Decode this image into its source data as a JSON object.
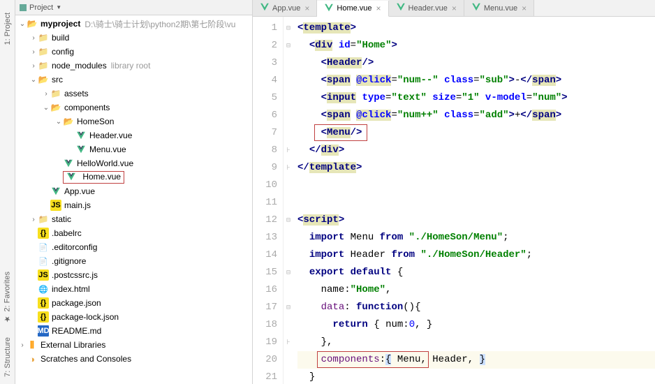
{
  "leftTools": {
    "project": "1: Project",
    "favorites": "2: Favorites",
    "structure": "7: Structure"
  },
  "sidebar": {
    "title": "Project",
    "tree": {
      "root": {
        "name": "myproject",
        "path": "D:\\骑士\\骑士计划\\python2期\\第七阶段\\vu"
      },
      "build": "build",
      "config": "config",
      "nodeModules": {
        "name": "node_modules",
        "hint": "library root"
      },
      "src": "src",
      "assets": "assets",
      "components": "components",
      "homeson": "HomeSon",
      "headerVue": "Header.vue",
      "menuVue": "Menu.vue",
      "helloWorld": "HelloWorld.vue",
      "homeVue": "Home.vue",
      "appVue": "App.vue",
      "mainJs": "main.js",
      "static": "static",
      "babelrc": ".babelrc",
      "editorconfig": ".editorconfig",
      "gitignore": ".gitignore",
      "postcssrc": ".postcssrc.js",
      "indexHtml": "index.html",
      "packageJson": "package.json",
      "packageLock": "package-lock.json",
      "readme": "README.md",
      "extLib": "External Libraries",
      "scratches": "Scratches and Consoles"
    }
  },
  "tabs": {
    "app": "App.vue",
    "home": "Home.vue",
    "header": "Header.vue",
    "menu": "Menu.vue"
  },
  "code": {
    "lines": {
      "1": "1",
      "2": "2",
      "3": "3",
      "4": "4",
      "5": "5",
      "6": "6",
      "7": "7",
      "8": "8",
      "9": "9",
      "10": "10",
      "11": "11",
      "12": "12",
      "13": "13",
      "14": "14",
      "15": "15",
      "16": "16",
      "17": "17",
      "18": "18",
      "19": "19",
      "20": "20",
      "21": "21"
    },
    "l1": {
      "open": "<",
      "tag": "template",
      "close": ">"
    },
    "l2": {
      "open": "<",
      "tag": "div",
      "attr": "id",
      "eq": "=",
      "q": "\"",
      "val": "Home",
      "close": ">"
    },
    "l3": {
      "open": "<",
      "tag": "Header",
      "close": "/>"
    },
    "l4": {
      "open": "<",
      "tag": "span",
      "attr1": "@click",
      "eq": "=",
      "q": "\"",
      "val1": "num--",
      "attr2": "class",
      "val2": "sub",
      "close": ">",
      "text": "-",
      "ctag": "</",
      "close2": ">"
    },
    "l5": {
      "open": "<",
      "tag": "input",
      "attr1": "type",
      "eq": "=",
      "q": "\"",
      "val1": "text",
      "attr2": "size",
      "val2": "1",
      "attr3": "v-model",
      "val3": "num",
      "close": ">"
    },
    "l6": {
      "open": "<",
      "tag": "span",
      "attr1": "@click",
      "eq": "=",
      "q": "\"",
      "val1": "num++",
      "attr2": "class",
      "val2": "add",
      "close": ">",
      "text": "+",
      "ctag": "</",
      "close2": ">"
    },
    "l7": {
      "open": "<",
      "tag": "Menu",
      "close": "/>"
    },
    "l8": {
      "open": "</",
      "tag": "div",
      "close": ">"
    },
    "l9": {
      "open": "</",
      "tag": "template",
      "close": ">"
    },
    "l12": {
      "open": "<",
      "tag": "script",
      "close": ">"
    },
    "l13": {
      "kw": "import",
      "name": "Menu",
      "from": "from",
      "path": "\"./HomeSon/Menu\"",
      "semi": ";"
    },
    "l14": {
      "kw": "import",
      "name": "Header",
      "from": "from",
      "path": "\"./HomeSon/Header\"",
      "semi": ";"
    },
    "l15": {
      "kw1": "export",
      "kw2": "default",
      "brace": "{"
    },
    "l16": {
      "key": "name",
      "colon": ":",
      "val": "\"Home\"",
      "comma": ","
    },
    "l17": {
      "key": "data",
      "colon": ":",
      "fn": "function",
      "paren": "()",
      "brace": "{"
    },
    "l18": {
      "ret": "return",
      "brace": "{",
      "key": "num",
      "colon": ":",
      "val": "0",
      "comma": ",",
      "cbrace": "}"
    },
    "l19": {
      "cbrace": "}",
      "comma": ","
    },
    "l20": {
      "key": "components",
      "colon": ":",
      "brace": "{",
      "m": "Menu",
      "c1": ",",
      "h": "Header",
      "c2": ",",
      "cbrace": "}"
    },
    "l21": {
      "cbrace": "}"
    }
  }
}
